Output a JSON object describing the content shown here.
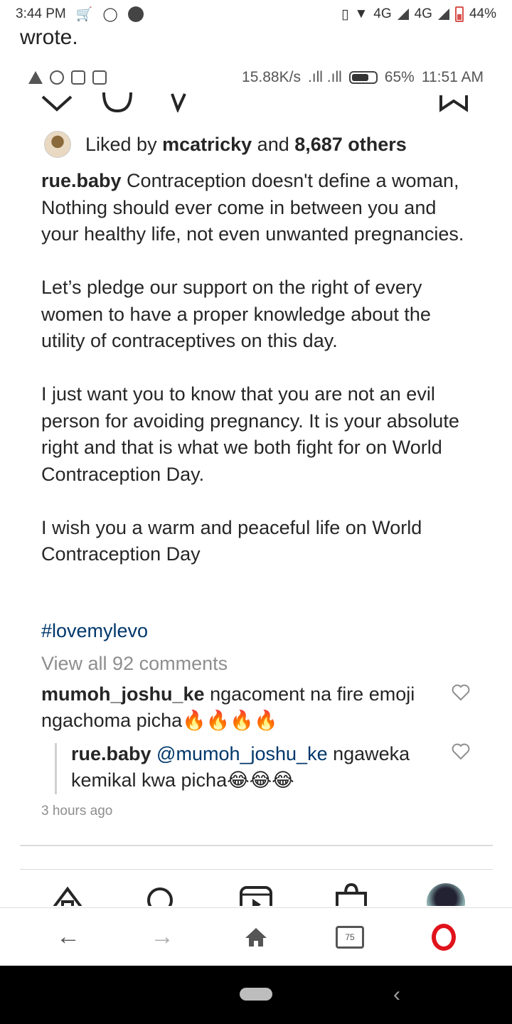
{
  "status_bar": {
    "time": "3:44 PM",
    "network": "4G",
    "network2": "4G",
    "battery": "44%"
  },
  "quote_fragment": "wrote.",
  "inner_status": {
    "speed": "15.88K/s",
    "battery": "65%",
    "time": "11:51 AM"
  },
  "likes": {
    "prefix": "Liked by ",
    "user": "mcatricky",
    "middle": " and ",
    "count": "8,687 others"
  },
  "caption": {
    "user": "rue.baby",
    "paragraphs": [
      " Contraception doesn't define a woman, Nothing should ever come in between you and your healthy life, not even unwanted pregnancies.",
      "Let’s pledge our support on the right of every women to have a proper knowledge about the utility of contraceptives on this day.",
      "I just want you to know that you are not an evil person for avoiding pregnancy. It is your absolute right and that is what we both fight for on World Contraception Day.",
      "I wish you a warm and peaceful life on World Contraception Day"
    ]
  },
  "hashtag": "#lovemylevo",
  "view_all": "View all 92 comments",
  "comment": {
    "user": "mumoh_joshu_ke",
    "text": " ngacoment na fire emoji ngachoma picha🔥🔥🔥🔥"
  },
  "reply": {
    "user": "rue.baby",
    "mention": " @mumoh_joshu_ke",
    "text": " ngaweka kemikal kwa picha😂😂😂"
  },
  "time_ago": "3 hours ago",
  "browser": {
    "tab_count": "75"
  },
  "icons": [
    "chevron-icon",
    "comment-icon",
    "share-icon",
    "bookmark-icon",
    "home-icon",
    "search-icon",
    "reels-icon",
    "shop-icon",
    "back-arrow-icon",
    "forward-arrow-icon",
    "browser-home-icon",
    "tabs-icon",
    "opera-icon"
  ]
}
